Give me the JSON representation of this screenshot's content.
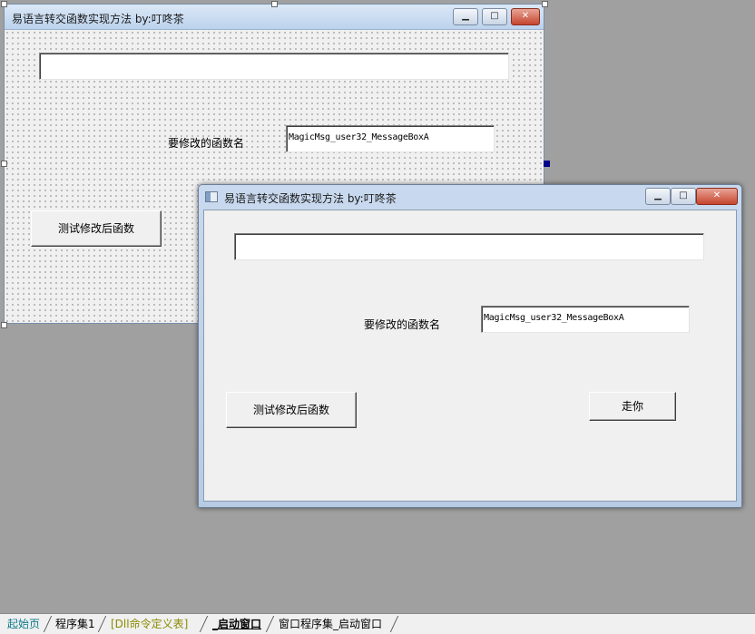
{
  "designer_form": {
    "title": "易语言转交函数实现方法 by:叮咚茶",
    "buttons": {
      "minimize": "▁",
      "maximize": "□",
      "close": "✕"
    },
    "label_func_name": "要修改的函数名",
    "func_name_value": "MagicMsg_user32_MessageBoxA",
    "top_input_value": "",
    "test_button": "测试修改后函数"
  },
  "running_form": {
    "title": "易语言转交函数实现方法 by:叮咚茶",
    "buttons": {
      "minimize": "▁",
      "maximize": "□",
      "close": "✕"
    },
    "label_func_name": "要修改的函数名",
    "func_name_value": "MagicMsg_user32_MessageBoxA",
    "top_input_value": "",
    "test_button": "测试修改后函数",
    "go_button": "走你"
  },
  "tabs": [
    {
      "label": "起始页",
      "color": "#0b7a8a"
    },
    {
      "label": "程序集1",
      "color": "#000000"
    },
    {
      "label": "[Dll命令定义表]",
      "color": "#8a8a00"
    },
    {
      "label": "_启动窗口",
      "color": "#000000",
      "active": true
    },
    {
      "label": "窗口程序集_启动窗口",
      "color": "#000000"
    }
  ]
}
